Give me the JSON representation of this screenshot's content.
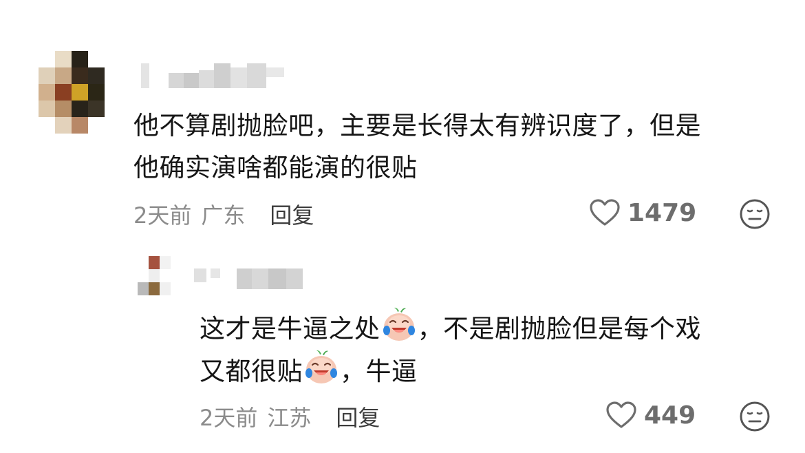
{
  "comments": [
    {
      "text_line1": "他不算剧抛脸吧，主要是长得太有辨识度了，但是",
      "text_line2": "他确实演啥都能演的很贴",
      "time": "2天前",
      "region": "广东",
      "reply_label": "回复",
      "likes": "1479",
      "like_icon": "heart-outline-icon",
      "dislike_icon": "meh-face-icon"
    }
  ],
  "replies": [
    {
      "text_line1_a": "这才是牛逼之处",
      "text_line1_b": "，不是剧抛脸但是每个戏",
      "text_line2_a": "又都很贴",
      "text_line2_b": "，牛逼",
      "emoji": "crying-laughing-peach-emoji",
      "time": "2天前",
      "region": "江苏",
      "reply_label": "回复",
      "likes": "449",
      "like_icon": "heart-outline-icon",
      "dislike_icon": "meh-face-icon"
    }
  ],
  "colors": {
    "text": "#161616",
    "meta": "#8b8b8b",
    "reply": "#3c3c3c",
    "like_count": "#6d6d6d",
    "background": "#ffffff"
  }
}
